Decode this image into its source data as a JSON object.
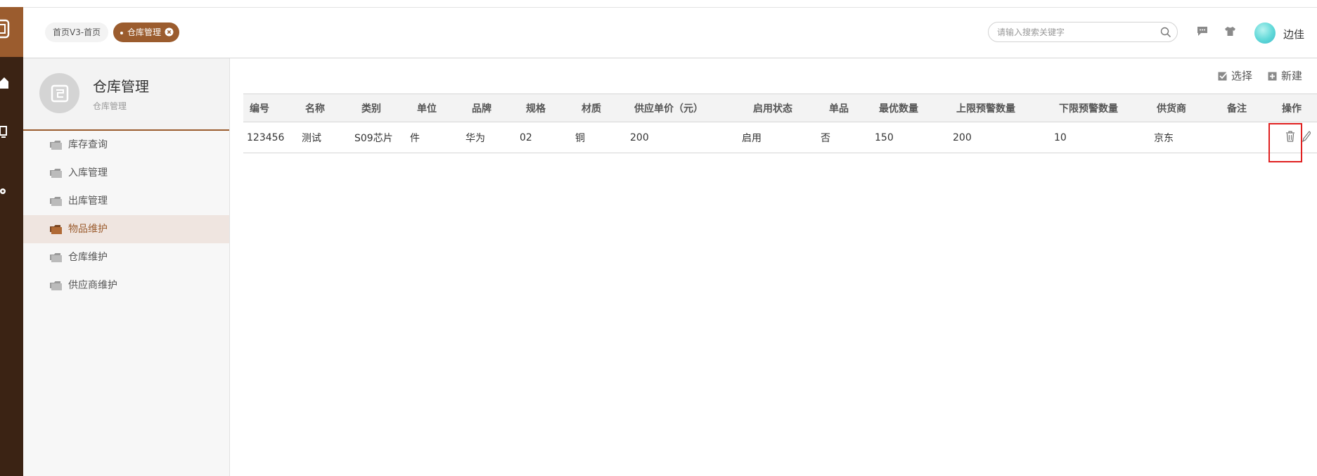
{
  "header": {
    "tabs": [
      {
        "label": "首页V3-首页",
        "active": false
      },
      {
        "label": "仓库管理",
        "active": true
      }
    ],
    "search": {
      "placeholder": "请输入搜索关键字"
    },
    "user": {
      "name": "边佳"
    }
  },
  "sidebar": {
    "title": "仓库管理",
    "subtitle": "仓库管理",
    "items": [
      {
        "label": "库存查询",
        "active": false
      },
      {
        "label": "入库管理",
        "active": false
      },
      {
        "label": "出库管理",
        "active": false
      },
      {
        "label": "物品维护",
        "active": true
      },
      {
        "label": "仓库维护",
        "active": false
      },
      {
        "label": "供应商维护",
        "active": false
      }
    ]
  },
  "toolbar": {
    "select_label": "选择",
    "new_label": "新建"
  },
  "table": {
    "columns": [
      "编号",
      "名称",
      "类别",
      "单位",
      "品牌",
      "规格",
      "材质",
      "供应单价（元）",
      "启用状态",
      "单品",
      "最优数量",
      "上限预警数量",
      "下限预警数量",
      "供货商",
      "备注",
      "操作"
    ],
    "rows": [
      [
        "123456",
        "测试",
        "S09芯片",
        "件",
        "华为",
        "02",
        "铜",
        "200",
        "启用",
        "否",
        "150",
        "200",
        "10",
        "京东",
        "",
        ""
      ]
    ]
  },
  "colors": {
    "brand": "#9b5c2e",
    "rail": "#3b2314",
    "highlight": "#e02020"
  }
}
